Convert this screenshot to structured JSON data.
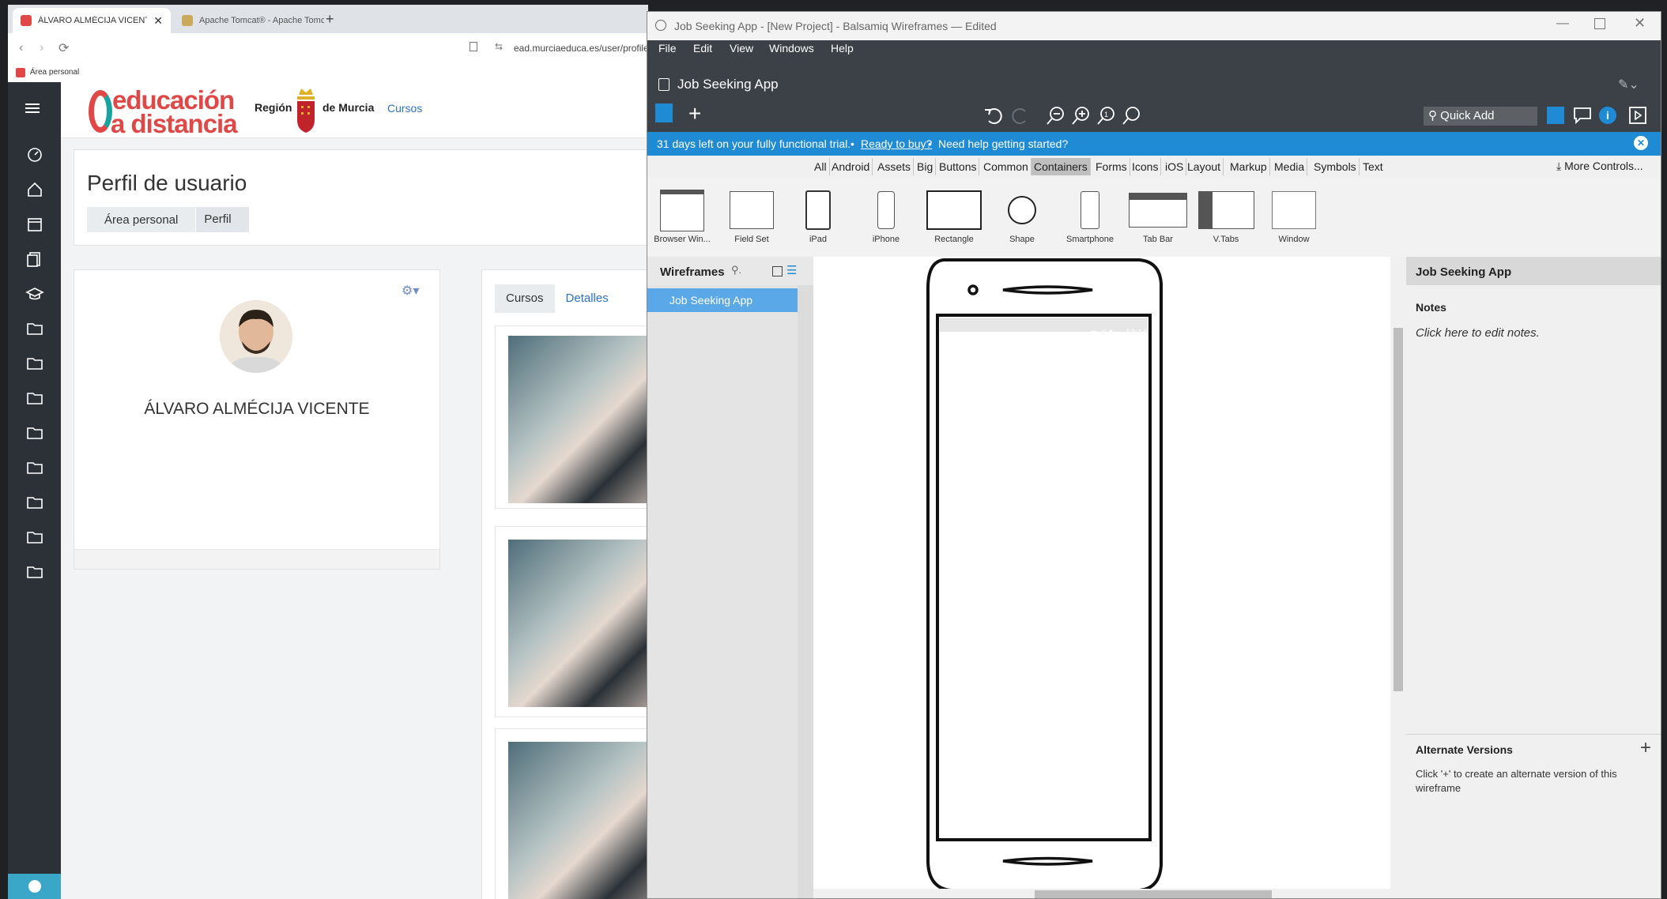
{
  "browser": {
    "tabs": [
      {
        "title": "ÁLVARO ALMÉCIJA VICENTE: Pe",
        "active": true
      },
      {
        "title": "Apache Tomcat® - Apache Tomcat",
        "active": false
      }
    ],
    "url": "ead.murciaeduca.es/user/profile.",
    "bookmark": "Área personal"
  },
  "moodle": {
    "logo_line1": "educación",
    "logo_line2": "a distancia",
    "region_left": "Región",
    "region_right": "de Murcia",
    "nav_link": "Cursos",
    "page_title": "Perfil de usuario",
    "breadcrumb": [
      "Área personal",
      "Perfil"
    ],
    "user_name": "ÁLVARO ALMÉCIJA VICENTE",
    "course_tabs": [
      "Cursos",
      "Detalles"
    ]
  },
  "balsamiq": {
    "window_title": "Job Seeking App - [New Project] - Balsamiq Wireframes — Edited",
    "menu": [
      "File",
      "Edit",
      "View",
      "Windows",
      "Help"
    ],
    "project_title": "Job Seeking App",
    "quick_add": "Quick Add",
    "trial_text": "31 days left on your fully functional trial.",
    "trial_bullet": "•",
    "trial_link": "Ready to buy?",
    "trial_help": "Need help getting started?",
    "categories": [
      "All",
      "Android",
      "Assets",
      "Big",
      "Buttons",
      "Common",
      "Containers",
      "Forms",
      "Icons",
      "iOS",
      "Layout",
      "Markup",
      "Media",
      "Symbols",
      "Text"
    ],
    "selected_category": "Containers",
    "more_controls": "More Controls...",
    "library": [
      "Browser Win...",
      "Field Set",
      "iPad",
      "iPhone",
      "Rectangle",
      "Shape",
      "Smartphone",
      "Tab Bar",
      "V.Tabs",
      "Window"
    ],
    "nav_title": "Wireframes",
    "nav_items": [
      "Job Seeking App"
    ],
    "phone_status_time": "13:14",
    "props_title": "Job Seeking App",
    "notes_label": "Notes",
    "notes_placeholder": "Click here to edit notes.",
    "alt_versions_label": "Alternate Versions",
    "alt_versions_hint": "Click '+' to create an alternate version of this wireframe",
    "colors": {
      "accent": "#1f8bd4",
      "dark": "#3c4147",
      "selected_nav": "#5aa8e8"
    }
  }
}
